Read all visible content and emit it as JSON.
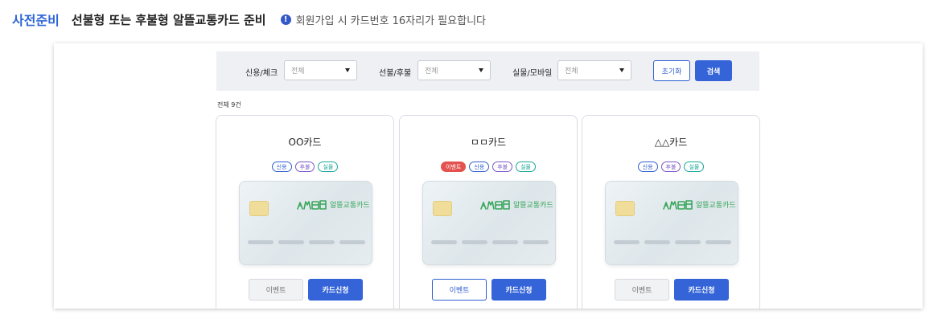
{
  "header": {
    "step": "사전준비",
    "title": "선불형 또는 후불형 알뜰교통카드 준비",
    "info": "회원가입 시 카드번호 16자리가 필요합니다"
  },
  "filters": [
    {
      "label": "신용/체크",
      "value": "전체"
    },
    {
      "label": "선불/후불",
      "value": "전체"
    },
    {
      "label": "실물/모바일",
      "value": "전체"
    }
  ],
  "buttons": {
    "reset": "초기화",
    "search": "검색"
  },
  "total": "전체 9건",
  "card_brand": "알뜰교통카드",
  "cards": [
    {
      "name": "OO카드",
      "tags": [
        "신용",
        "후불",
        "실물"
      ],
      "event_label": "이벤트",
      "apply_label": "카드신청",
      "event_active": false
    },
    {
      "name": "ㅁㅁ카드",
      "tags": [
        "이벤트",
        "신용",
        "후불",
        "실물"
      ],
      "event_label": "이벤트",
      "apply_label": "카드신청",
      "event_active": true
    },
    {
      "name": "△△카드",
      "tags": [
        "신용",
        "후불",
        "실물"
      ],
      "event_label": "이벤트",
      "apply_label": "카드신청",
      "event_active": false
    }
  ],
  "colors": {
    "accent": "#3464d8",
    "event_tag": "#e3524f",
    "credit_tag": "#2f5fd0",
    "post_tag": "#7a57c7",
    "real_tag": "#1aa79a"
  }
}
